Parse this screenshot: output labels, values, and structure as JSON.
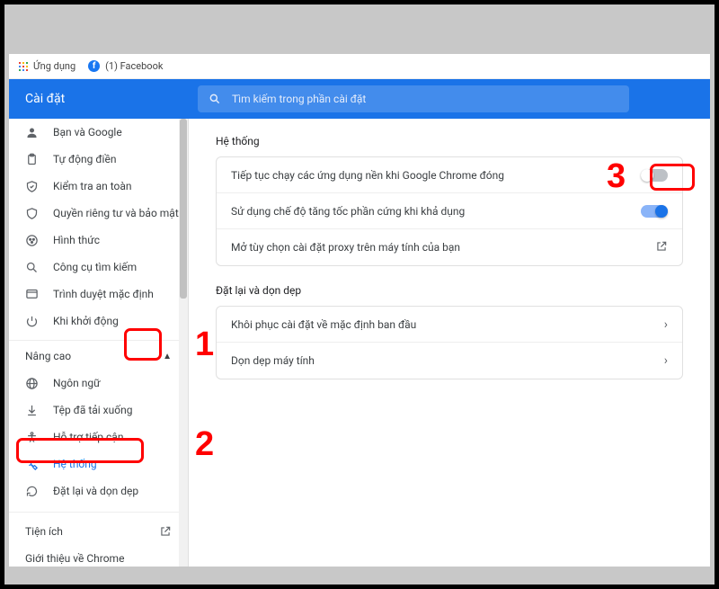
{
  "bookmarks": {
    "apps": "Ứng dụng",
    "fb": "(1) Facebook"
  },
  "header": {
    "title": "Cài đặt",
    "search_placeholder": "Tìm kiếm trong phần cài đặt"
  },
  "sidebar": {
    "items_top": [
      {
        "label": "Bạn và Google",
        "name": "sidebar-item-you-and-google",
        "icon": "person"
      },
      {
        "label": "Tự động điền",
        "name": "sidebar-item-autofill",
        "icon": "clipboard"
      },
      {
        "label": "Kiểm tra an toàn",
        "name": "sidebar-item-safety-check",
        "icon": "safety"
      },
      {
        "label": "Quyền riêng tư và bảo mật",
        "name": "sidebar-item-privacy",
        "icon": "privacy"
      },
      {
        "label": "Hình thức",
        "name": "sidebar-item-appearance",
        "icon": "appearance"
      },
      {
        "label": "Công cụ tìm kiếm",
        "name": "sidebar-item-search-engine",
        "icon": "search"
      },
      {
        "label": "Trình duyệt mặc định",
        "name": "sidebar-item-default-browser",
        "icon": "browser"
      },
      {
        "label": "Khi khởi động",
        "name": "sidebar-item-on-startup",
        "icon": "power"
      }
    ],
    "advanced_label": "Nâng cao",
    "items_adv": [
      {
        "label": "Ngôn ngữ",
        "name": "sidebar-item-languages",
        "icon": "globe"
      },
      {
        "label": "Tệp đã tải xuống",
        "name": "sidebar-item-downloads",
        "icon": "download"
      },
      {
        "label": "Hỗ trợ tiếp cận",
        "name": "sidebar-item-accessibility",
        "icon": "a11y"
      },
      {
        "label": "Hệ thống",
        "name": "sidebar-item-system",
        "icon": "wrench",
        "active": true
      },
      {
        "label": "Đặt lại và dọn dẹp",
        "name": "sidebar-item-reset",
        "icon": "reset"
      }
    ],
    "footer": {
      "extensions": "Tiện ích",
      "about": "Giới thiệu về Chrome"
    }
  },
  "main": {
    "system": {
      "title": "Hệ thống",
      "rows": [
        {
          "label": "Tiếp tục chạy các ứng dụng nền khi Google Chrome đóng",
          "control": "toggle-off"
        },
        {
          "label": "Sử dụng chế độ tăng tốc phần cứng khi khả dụng",
          "control": "toggle-on"
        },
        {
          "label": "Mở tùy chọn cài đặt proxy trên máy tính của bạn",
          "control": "launch"
        }
      ]
    },
    "reset": {
      "title": "Đặt lại và dọn dẹp",
      "rows": [
        {
          "label": "Khôi phục cài đặt về mặc định ban đầu",
          "control": "chevron"
        },
        {
          "label": "Dọn dẹp máy tính",
          "control": "chevron"
        }
      ]
    }
  },
  "annotations": {
    "n1": "1",
    "n2": "2",
    "n3": "3"
  }
}
